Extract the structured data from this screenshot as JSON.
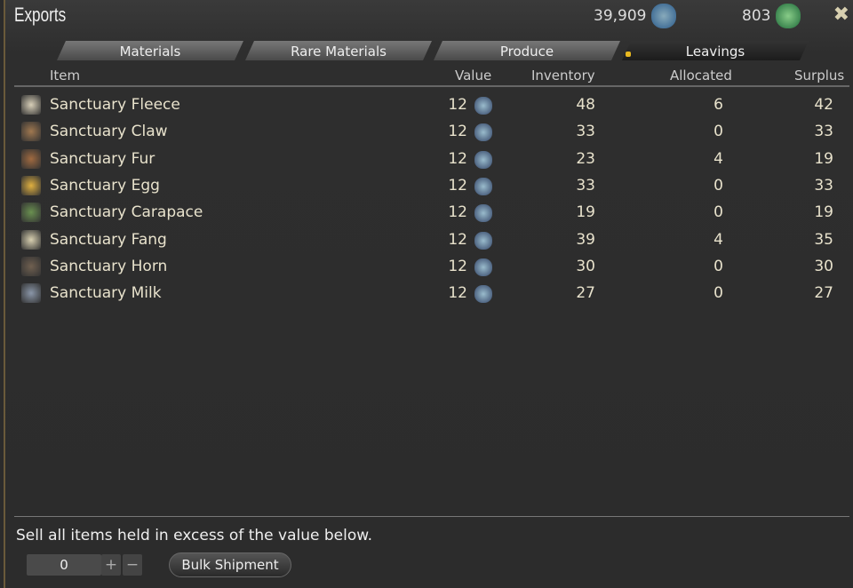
{
  "window": {
    "title": "Exports"
  },
  "currency": [
    {
      "value": "39,909",
      "icon": "blue-seal-icon",
      "color": "#4a78a8"
    },
    {
      "value": "803",
      "icon": "green-seal-icon",
      "color": "#2f8a4a"
    }
  ],
  "tabs": [
    {
      "label": "Materials"
    },
    {
      "label": "Rare Materials"
    },
    {
      "label": "Produce"
    },
    {
      "label": "Leavings",
      "active": true
    }
  ],
  "columns": {
    "item": "Item",
    "value": "Value",
    "inventory": "Inventory",
    "allocated": "Allocated",
    "surplus": "Surplus"
  },
  "rows": [
    {
      "name": "Sanctuary Fleece",
      "value": "12",
      "inventory": "48",
      "allocated": "6",
      "surplus": "42",
      "color": "#d8cfb8"
    },
    {
      "name": "Sanctuary Claw",
      "value": "12",
      "inventory": "33",
      "allocated": "0",
      "surplus": "33",
      "color": "#a07850"
    },
    {
      "name": "Sanctuary Fur",
      "value": "12",
      "inventory": "23",
      "allocated": "4",
      "surplus": "19",
      "color": "#a06a40"
    },
    {
      "name": "Sanctuary Egg",
      "value": "12",
      "inventory": "33",
      "allocated": "0",
      "surplus": "33",
      "color": "#e0b040"
    },
    {
      "name": "Sanctuary Carapace",
      "value": "12",
      "inventory": "19",
      "allocated": "0",
      "surplus": "19",
      "color": "#6a9050"
    },
    {
      "name": "Sanctuary Fang",
      "value": "12",
      "inventory": "39",
      "allocated": "4",
      "surplus": "35",
      "color": "#d8d0b0"
    },
    {
      "name": "Sanctuary Horn",
      "value": "12",
      "inventory": "30",
      "allocated": "0",
      "surplus": "30",
      "color": "#706050"
    },
    {
      "name": "Sanctuary Milk",
      "value": "12",
      "inventory": "27",
      "allocated": "0",
      "surplus": "27",
      "color": "#8a96a8"
    }
  ],
  "footer": {
    "instruction": "Sell all items held in excess of the value below.",
    "quantity": "0",
    "plus": "+",
    "minus": "−",
    "bulk_label": "Bulk Shipment"
  }
}
